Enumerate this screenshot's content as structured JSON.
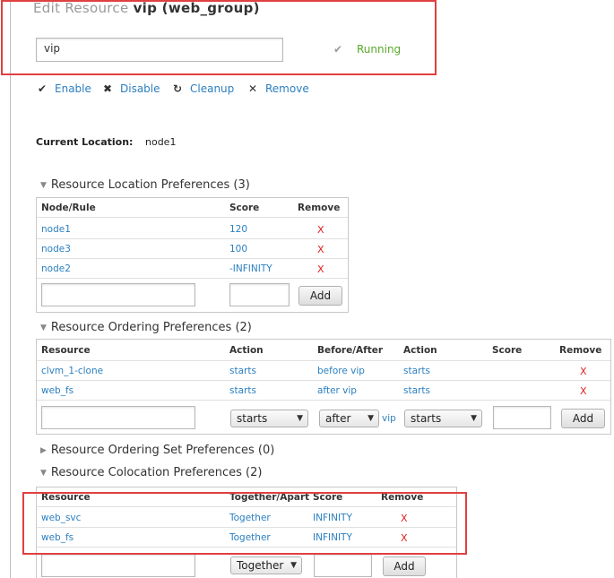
{
  "header": {
    "title_prefix": "Edit Resource",
    "title_bold": "vip (web_group)",
    "resource_name_value": "vip",
    "status_check": "✔",
    "status_text": "Running"
  },
  "actions": [
    {
      "icon": "check-icon",
      "glyph": "✔",
      "label": "Enable"
    },
    {
      "icon": "disable-icon",
      "glyph": "✖",
      "label": "Disable"
    },
    {
      "icon": "refresh-icon",
      "glyph": "↻",
      "label": "Cleanup"
    },
    {
      "icon": "remove-icon",
      "glyph": "✕",
      "label": "Remove"
    }
  ],
  "current_location": {
    "label": "Current Location:",
    "value": "node1"
  },
  "location_prefs": {
    "title": "Resource Location Preferences (3)",
    "headers": [
      "Node/Rule",
      "Score",
      "Remove"
    ],
    "rows": [
      {
        "node": "node1",
        "score": "120",
        "remove": "X"
      },
      {
        "node": "node3",
        "score": "100",
        "remove": "X"
      },
      {
        "node": "node2",
        "score": "-INFINITY",
        "remove": "X"
      }
    ],
    "add_label": "Add"
  },
  "ordering_prefs": {
    "title": "Resource Ordering Preferences (2)",
    "headers": [
      "Resource",
      "Action",
      "Before/After",
      "Action",
      "Score",
      "Remove"
    ],
    "rows": [
      {
        "resource": "clvm_1-clone",
        "action": "starts",
        "before_after": "before vip",
        "action2": "starts",
        "score": "",
        "remove": "X"
      },
      {
        "resource": "web_fs",
        "action": "starts",
        "before_after": "after vip",
        "action2": "starts",
        "score": "",
        "remove": "X"
      }
    ],
    "select_action": "starts",
    "select_before_after": "after",
    "vip_label": "vip",
    "select_action2": "starts",
    "add_label": "Add"
  },
  "ordering_set_prefs": {
    "title": "Resource Ordering Set Preferences (0)"
  },
  "colocation_prefs": {
    "title": "Resource Colocation Preferences (2)",
    "headers": [
      "Resource",
      "Together/Apart",
      "Score",
      "Remove"
    ],
    "rows": [
      {
        "resource": "web_svc",
        "together": "Together",
        "score": "INFINITY",
        "remove": "X"
      },
      {
        "resource": "web_fs",
        "together": "Together",
        "score": "INFINITY",
        "remove": "X"
      }
    ],
    "select_together": "Together",
    "add_label": "Add"
  },
  "colors": {
    "link": "#2b7fc0",
    "running": "#59a82b",
    "remove_x": "#e02020",
    "highlight": "#e04040"
  }
}
